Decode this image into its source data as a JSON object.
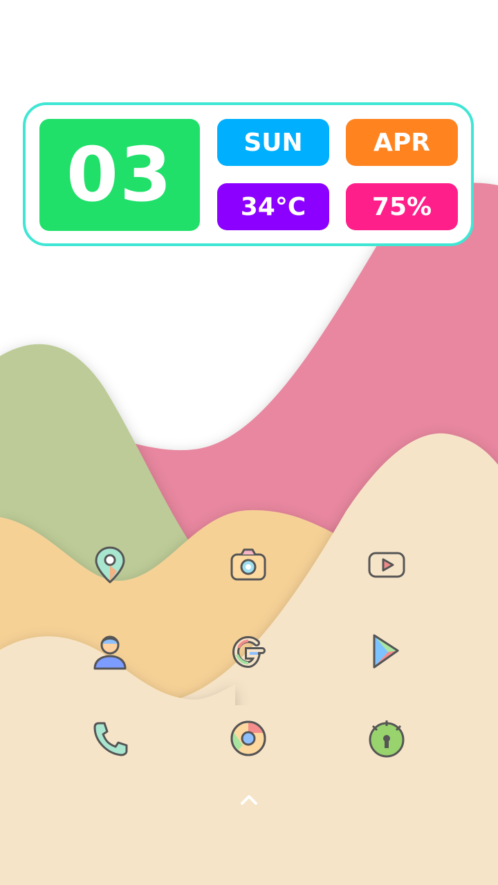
{
  "widget": {
    "day": "03",
    "weekday": "SUN",
    "month": "APR",
    "temperature": "34°C",
    "battery": "75%"
  },
  "colors": {
    "widget_border": "#3fe6d4",
    "day_tile": "#20e06a",
    "weekday_tile": "#00b0ff",
    "month_tile": "#ff8420",
    "temperature_tile": "#8c00ff",
    "battery_tile": "#ff1f8a",
    "wave_green": "#bccb97",
    "wave_pink": "#e8879f",
    "wave_orange": "#f6d196",
    "wave_cream": "#f6e4c8"
  },
  "home_icons": [
    {
      "name": "maps-icon"
    },
    {
      "name": "camera-icon"
    },
    {
      "name": "youtube-icon"
    },
    {
      "name": "contacts-icon"
    },
    {
      "name": "google-icon"
    },
    {
      "name": "play-store-icon"
    },
    {
      "name": "phone-icon"
    },
    {
      "name": "chrome-icon"
    },
    {
      "name": "lock-icon"
    }
  ],
  "app_drawer": {
    "icon": "chevron-up-icon"
  }
}
